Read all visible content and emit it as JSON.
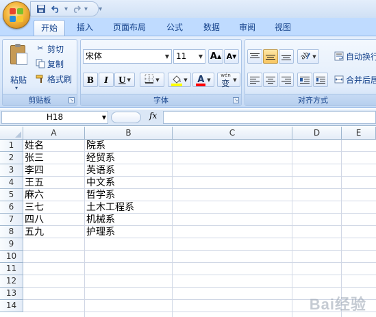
{
  "quick_access": {
    "save_icon": "save-icon",
    "undo_icon": "undo-icon",
    "redo_icon": "redo-icon",
    "customize_icon": "customize-icon"
  },
  "tabs": [
    {
      "label": "开始",
      "active": true
    },
    {
      "label": "插入"
    },
    {
      "label": "页面布局"
    },
    {
      "label": "公式"
    },
    {
      "label": "数据"
    },
    {
      "label": "审阅"
    },
    {
      "label": "视图"
    }
  ],
  "ribbon": {
    "clipboard": {
      "paste": "粘贴",
      "cut": "剪切",
      "copy": "复制",
      "format_painter": "格式刷",
      "label": "剪贴板"
    },
    "font": {
      "font_name": "宋体",
      "font_size": "11",
      "grow": "A",
      "shrink": "A",
      "bold": "B",
      "italic": "I",
      "underline": "U",
      "font_color_glyph": "A",
      "phonetic_top": "wén",
      "phonetic_glyph": "变",
      "label": "字体",
      "colors": {
        "fill": "#ffff00",
        "font": "#ff0000"
      }
    },
    "alignment": {
      "wrap_text": "自动换行",
      "merge": "合并后居",
      "label": "对齐方式"
    }
  },
  "formula_bar": {
    "name_box": "H18",
    "fx": "fx",
    "value": ""
  },
  "sheet": {
    "columns": [
      "A",
      "B",
      "C",
      "D",
      "E"
    ],
    "rows": [
      "1",
      "2",
      "3",
      "4",
      "5",
      "6",
      "7",
      "8",
      "9",
      "10",
      "11",
      "12",
      "13",
      "14"
    ],
    "cells": [
      [
        "姓名",
        "院系"
      ],
      [
        "张三",
        "经贸系"
      ],
      [
        "李四",
        "英语系"
      ],
      [
        "王五",
        "中文系"
      ],
      [
        "麻六",
        "哲学系"
      ],
      [
        "三七",
        "土木工程系"
      ],
      [
        "四八",
        "机械系"
      ],
      [
        "五九",
        "护理系"
      ]
    ]
  },
  "watermark": "Bai经验"
}
